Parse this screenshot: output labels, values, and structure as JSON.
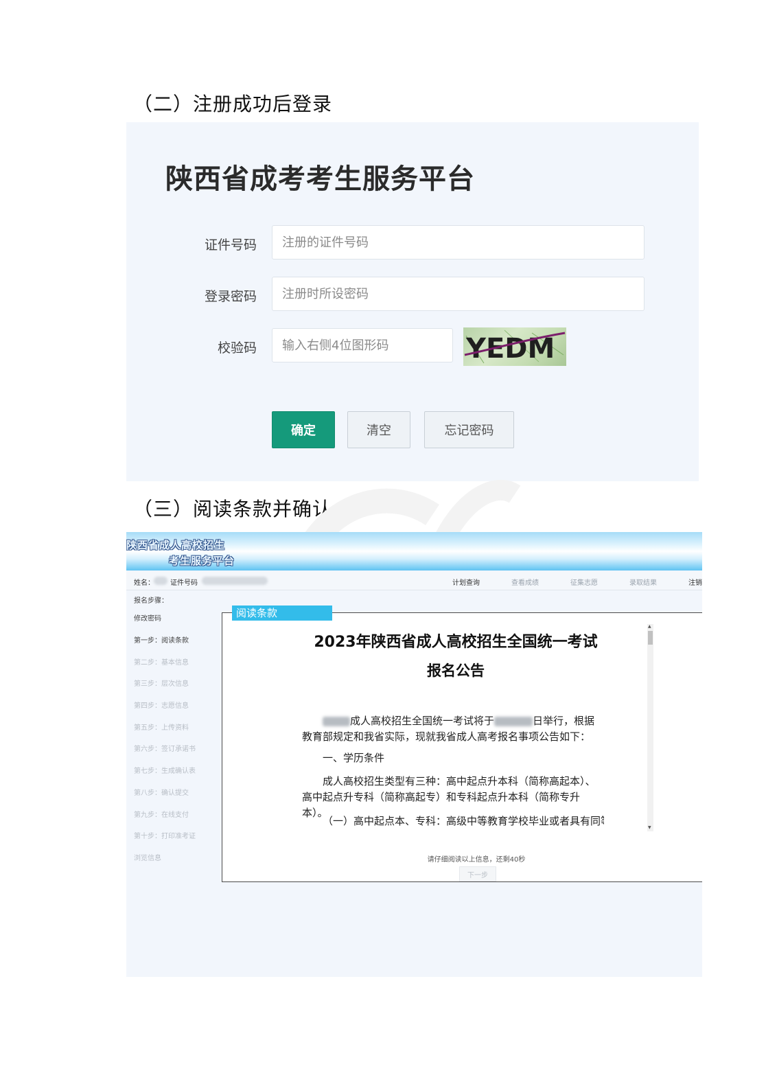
{
  "section2": {
    "heading": "（二）注册成功后登录",
    "login": {
      "platform_title": "陕西省成考考生服务平台",
      "id_label": "证件号码",
      "id_placeholder": "注册的证件号码",
      "password_label": "登录密码",
      "password_placeholder": "注册时所设密码",
      "captcha_label": "校验码",
      "captcha_placeholder": "输入右侧4位图形码",
      "captcha_text": "YEDM",
      "confirm_button": "确定",
      "clear_button": "清空",
      "forgot_button": "忘记密码"
    }
  },
  "section3": {
    "heading": "（三）阅读条款并确认",
    "portal": {
      "banner_line1": "陕西省成人高校招生",
      "banner_line2": "考生服务平台",
      "name_label": "姓名：",
      "id_label": "证件号码",
      "nav": {
        "plan": "计划查询",
        "score": "查看成绩",
        "volunteer": "征集志愿",
        "admission": "录取结果",
        "logout": "注销"
      },
      "steps_header": "报名步骤：",
      "change_password": "修改密码",
      "steps": [
        "第一步：阅读条款",
        "第二步：基本信息",
        "第三步：层次信息",
        "第四步：志愿信息",
        "第五步：上传资料",
        "第六步：签订承诺书",
        "第七步：生成确认表",
        "第八步：确认提交",
        "第九步：在线支付",
        "第十步：打印准考证"
      ],
      "browse_info": "浏览信息",
      "panel_tab": "阅读条款",
      "notice_title": "2023年陕西省成人高校招生全国统一考试",
      "notice_subtitle": "报名公告",
      "para1_a": "成人高校招生全国统一考试将于",
      "para1_b": "日举行，根据教育部规定和我省实际，现就我省成人高考报名事项公告如下：",
      "para2": "一、学历条件",
      "para3": "成人高校招生类型有三种：高中起点升本科（简称高起本）、高中起点升专科（简称高起专）和专科起点升本科（简称专升本）。",
      "para4": "（一）高中起点本、专科：高级中等教育学校毕业或者具有同等学",
      "countdown": "请仔细阅读以上信息，还剩40秒",
      "next_button": "下一步"
    }
  }
}
